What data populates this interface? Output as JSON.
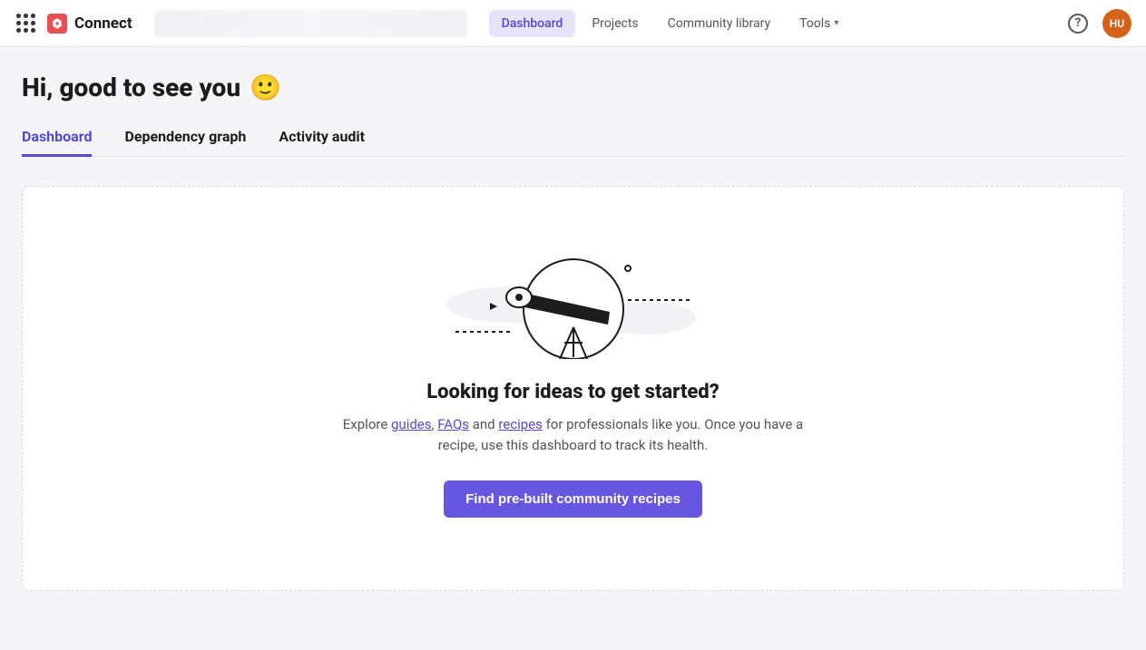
{
  "header": {
    "brand_name": "Connect",
    "nav": {
      "dashboard": "Dashboard",
      "projects": "Projects",
      "community_library": "Community library",
      "tools": "Tools"
    },
    "avatar_initials": "HU"
  },
  "main": {
    "greeting": "Hi, good to see you",
    "greeting_emoji": "🙂",
    "tabs": {
      "dashboard": "Dashboard",
      "dependency_graph": "Dependency graph",
      "activity_audit": "Activity audit"
    }
  },
  "card": {
    "title": "Looking for ideas to get started?",
    "text_prefix": "Explore ",
    "link_guides": "guides",
    "text_comma": ", ",
    "link_faqs": "FAQs",
    "text_and": " and ",
    "link_recipes": "recipes",
    "text_suffix": " for professionals like you. Once you have a recipe, use this dashboard to track its health.",
    "cta_label": "Find pre-built community recipes"
  }
}
